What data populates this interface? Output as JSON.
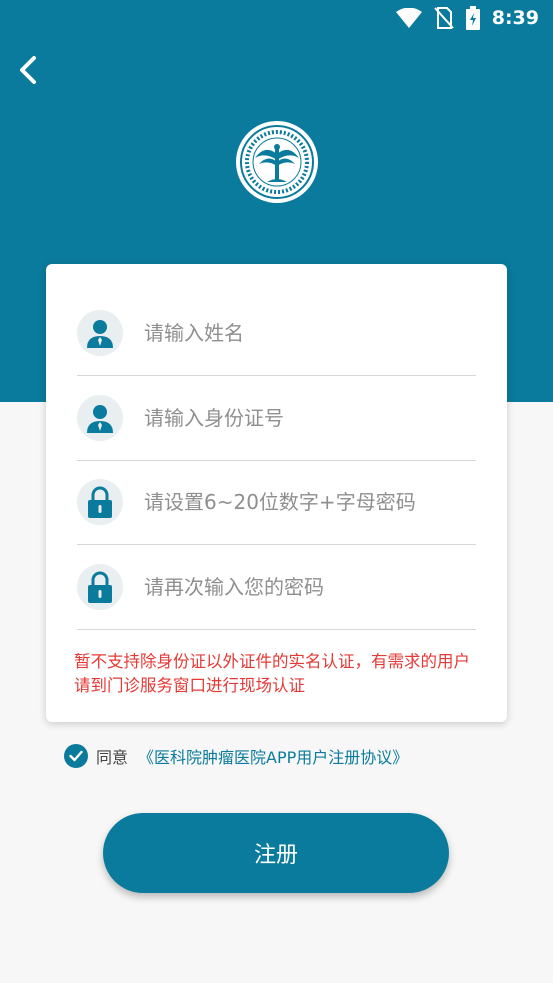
{
  "status_bar": {
    "time": "8:39"
  },
  "form": {
    "name_placeholder": "请输入姓名",
    "id_placeholder": "请输入身份证号",
    "password_placeholder": "请设置6~20位数字+字母密码",
    "confirm_placeholder": "请再次输入您的密码"
  },
  "notice": "暂不支持除身份证以外证件的实名认证，有需求的用户请到门诊服务窗口进行现场认证",
  "agreement": {
    "label": "同意",
    "link": "《医科院肿瘤医院APP用户注册协议》"
  },
  "register_button": "注册",
  "colors": {
    "primary": "#0a7b9c",
    "warning": "#e53935"
  }
}
